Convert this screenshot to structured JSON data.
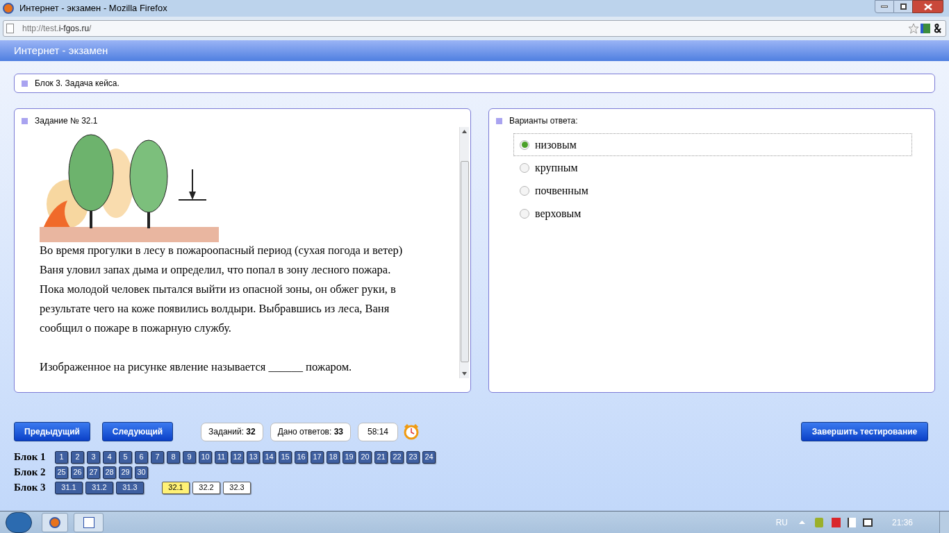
{
  "window": {
    "title": "Интернет - экзамен - Mozilla Firefox"
  },
  "address_bar": {
    "url_prefix": "http://test.",
    "url_domain": "i-fgos.ru",
    "url_suffix": "/"
  },
  "app_header": "Интернет - экзамен",
  "block_title": "Блок 3. Задача кейса.",
  "task": {
    "title": "Задание № 32.1",
    "paragraph": "Во время прогулки в лесу в пожароопасный период (сухая погода и ветер) Ваня уловил запах дыма и определил, что попал в зону лесного пожара. Пока молодой человек пытался выйти из опасной зоны, он обжег руки, в результате чего на коже появились волдыри. Выбравшись из леса, Ваня сообщил о пожаре в пожарную службу.",
    "question": "Изображенное на рисунке явление называется ______ пожаром."
  },
  "answers": {
    "title": "Варианты ответа:",
    "options": [
      {
        "label": "низовым",
        "selected": true
      },
      {
        "label": "крупным",
        "selected": false
      },
      {
        "label": "почвенным",
        "selected": false
      },
      {
        "label": "верховым",
        "selected": false
      }
    ]
  },
  "nav": {
    "prev": "Предыдущий",
    "next": "Следующий",
    "finish": "Завершить тестирование"
  },
  "counters": [
    {
      "label": "Заданий:",
      "value": "32"
    },
    {
      "label": "Дано ответов:",
      "value": "33"
    }
  ],
  "timer": "58:14",
  "blocks": [
    {
      "label": "Блок 1",
      "items": [
        {
          "label": "1",
          "answered": true,
          "selected": false
        },
        {
          "label": "2",
          "answered": true,
          "selected": false
        },
        {
          "label": "3",
          "answered": true,
          "selected": false
        },
        {
          "label": "4",
          "answered": true,
          "selected": false
        },
        {
          "label": "5",
          "answered": true,
          "selected": false
        },
        {
          "label": "6",
          "answered": true,
          "selected": false
        },
        {
          "label": "7",
          "answered": true,
          "selected": false
        },
        {
          "label": "8",
          "answered": true,
          "selected": false
        },
        {
          "label": "9",
          "answered": true,
          "selected": false
        },
        {
          "label": "10",
          "answered": true,
          "selected": false
        },
        {
          "label": "11",
          "answered": true,
          "selected": false
        },
        {
          "label": "12",
          "answered": true,
          "selected": false
        },
        {
          "label": "13",
          "answered": true,
          "selected": false
        },
        {
          "label": "14",
          "answered": true,
          "selected": false
        },
        {
          "label": "15",
          "answered": true,
          "selected": false
        },
        {
          "label": "16",
          "answered": true,
          "selected": false
        },
        {
          "label": "17",
          "answered": true,
          "selected": false
        },
        {
          "label": "18",
          "answered": true,
          "selected": false
        },
        {
          "label": "19",
          "answered": true,
          "selected": false
        },
        {
          "label": "20",
          "answered": true,
          "selected": false
        },
        {
          "label": "21",
          "answered": true,
          "selected": false
        },
        {
          "label": "22",
          "answered": true,
          "selected": false
        },
        {
          "label": "23",
          "answered": true,
          "selected": false
        },
        {
          "label": "24",
          "answered": true,
          "selected": false
        }
      ]
    },
    {
      "label": "Блок 2",
      "items": [
        {
          "label": "25",
          "answered": true,
          "selected": false
        },
        {
          "label": "26",
          "answered": true,
          "selected": false
        },
        {
          "label": "27",
          "answered": true,
          "selected": false
        },
        {
          "label": "28",
          "answered": true,
          "selected": false
        },
        {
          "label": "29",
          "answered": true,
          "selected": false
        },
        {
          "label": "30",
          "answered": true,
          "selected": false
        }
      ]
    },
    {
      "label": "Блок 3",
      "items": [
        {
          "label": "31.1",
          "answered": true,
          "selected": false
        },
        {
          "label": "31.2",
          "answered": true,
          "selected": false
        },
        {
          "label": "31.3",
          "answered": true,
          "selected": false
        },
        {
          "label": "32.1",
          "answered": false,
          "selected": true
        },
        {
          "label": "32.2",
          "answered": false,
          "selected": false
        },
        {
          "label": "32.3",
          "answered": false,
          "selected": false
        }
      ]
    }
  ],
  "taskbar": {
    "language": "RU",
    "clock": "21:36"
  }
}
